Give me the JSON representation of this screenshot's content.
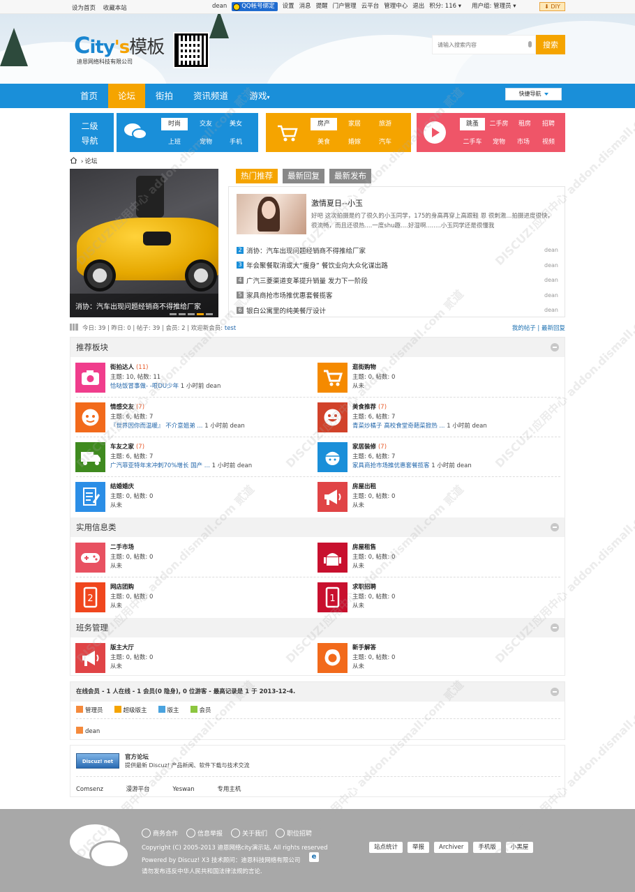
{
  "topbar": {
    "left": [
      "设为首页",
      "收藏本站"
    ],
    "user": "dean",
    "qq_bind": "QQ帐号绑定",
    "items": [
      "设置",
      "消息",
      "提醒",
      "门户管理",
      "云平台",
      "管理中心",
      "退出",
      "积分: 116",
      "用户组: 管理员"
    ],
    "diy": "DIY"
  },
  "header": {
    "logo_c": "C",
    "logo_ity": "ity",
    "logo_s": "'s",
    "logo_cn": "模板",
    "logo_sub": "迪恩网络科技有限公司",
    "search_placeholder": "请输入搜索内容",
    "search_button": "搜索"
  },
  "nav": {
    "items": [
      "首页",
      "论坛",
      "街拍",
      "资讯频道",
      "游戏"
    ],
    "active": "论坛",
    "quick": "快捷导航"
  },
  "subnav": {
    "label1": "二级",
    "label2": "导航",
    "group1": [
      "时尚",
      "交友",
      "美女",
      "上班",
      "宠物",
      "手机"
    ],
    "group2": [
      "房产",
      "家居",
      "旅游",
      "美食",
      "婚嫁",
      "汽车"
    ],
    "group3": [
      "跳蚤",
      "二手房",
      "租房",
      "招聘",
      "二手车",
      "宠物",
      "市场",
      "视频"
    ],
    "colors": {
      "blue": "#1a8fd9",
      "orange": "#f5a400",
      "red": "#ef5568"
    }
  },
  "breadcrumb": "论坛",
  "slide": {
    "caption": "消协：汽车出现问题经销商不得推给厂家"
  },
  "hot": {
    "tabs": [
      "热门推荐",
      "最新回复",
      "最新发布"
    ],
    "feature_title": "激情夏日--小玉",
    "feature_desc": "好吧 这次拍摄是约了很久的小玉同学，175的身高再穿上高跟鞋 恩 很刺激...拍摄进度很快，很流畅，而且还很热....一度shu趣....好湿啊........小玉同学还是很懂我",
    "list": [
      {
        "n": "2",
        "t": "消协：汽车出现问题经销商不得推给厂家",
        "a": "dean"
      },
      {
        "n": "3",
        "t": "年会聚餐取消或大“瘦身” 餐饮业向大众化谋出路",
        "a": "dean"
      },
      {
        "n": "4",
        "t": "广汽三菱渠道变革提升销量 发力下一阶段",
        "a": "dean"
      },
      {
        "n": "5",
        "t": "家具商抢市场推优惠套餐揽客",
        "a": "dean"
      },
      {
        "n": "6",
        "t": "银白公寓里的纯美餐厅设计",
        "a": "dean"
      }
    ]
  },
  "stats": {
    "text": "今日: 39 | 昨日: 0 | 帖子: 39 | 会员: 2 | 欢迎新会员: ",
    "newmember": "test",
    "right1": "我的帖子",
    "right2": "最新回复"
  },
  "sections": [
    {
      "title": "推荐板块",
      "forums": [
        {
          "name": "街拍达人",
          "count": "(11)",
          "stat": "主题: 10, 帖数: 11",
          "last": "恰哒饭冒事做- -哏DU少年",
          "time": " 1 小时前 dean",
          "icon": "camera-icon",
          "color": "#f03d8c"
        },
        {
          "name": "逛街购物",
          "count": "",
          "stat": "主题: 0, 帖数: 0",
          "last": "",
          "time": "从未",
          "icon": "cart-icon",
          "color": "#f58a00"
        },
        {
          "name": "情感交友",
          "count": "(7)",
          "stat": "主题: 6, 帖数: 7",
          "last": "『世界因你而温暖』 不介意姐弟 ...",
          "time": " 1 小时前 dean",
          "icon": "face-icon",
          "color": "#f26a1b"
        },
        {
          "name": "美食推荐",
          "count": "(7)",
          "stat": "主题: 6, 帖数: 7",
          "last": "青菜炒橘子 高校食堂奇葩菜掀热 ...",
          "time": " 1 小时前 dean",
          "icon": "smile-icon",
          "color": "#d1422a"
        },
        {
          "name": "车友之家",
          "count": "(7)",
          "stat": "主题: 6, 帖数: 7",
          "last": "广汽菲亚特年末冲刺70%增长 国产 ...",
          "time": " 1 小时前 dean",
          "icon": "truck-icon",
          "color": "#3f8a1f"
        },
        {
          "name": "家居装修",
          "count": "(7)",
          "stat": "主题: 6, 帖数: 7",
          "last": "家具商抢市场推优惠套餐揽客",
          "time": " 1 小时前 dean",
          "icon": "worker-icon",
          "color": "#1a8fd9"
        },
        {
          "name": "结婚婚庆",
          "count": "",
          "stat": "主题: 0, 帖数: 0",
          "last": "",
          "time": "从未",
          "icon": "document-icon",
          "color": "#2b8ee6"
        },
        {
          "name": "房屋出租",
          "count": "",
          "stat": "主题: 0, 帖数: 0",
          "last": "",
          "time": "从未",
          "icon": "megaphone-icon",
          "color": "#e04446"
        }
      ]
    },
    {
      "title": "实用信息类",
      "forums": [
        {
          "name": "二手市场",
          "count": "",
          "stat": "主题: 0, 帖数: 0",
          "last": "",
          "time": "从未",
          "icon": "gamepad-icon",
          "color": "#e85161"
        },
        {
          "name": "房屋租售",
          "count": "",
          "stat": "主题: 0, 帖数: 0",
          "last": "",
          "time": "从未",
          "icon": "android-icon",
          "color": "#c8102e"
        },
        {
          "name": "网店团购",
          "count": "",
          "stat": "主题: 0, 帖数: 0",
          "last": "",
          "time": "从未",
          "icon": "phone-2-icon",
          "color": "#f0461d"
        },
        {
          "name": "求职招聘",
          "count": "",
          "stat": "主题: 0, 帖数: 0",
          "last": "",
          "time": "从未",
          "icon": "phone-1-icon",
          "color": "#c8102e"
        }
      ]
    },
    {
      "title": "班务管理",
      "forums": [
        {
          "name": "版主大厅",
          "count": "",
          "stat": "主题: 0, 帖数: 0",
          "last": "",
          "time": "从未",
          "icon": "megaphone-icon",
          "color": "#e04446"
        },
        {
          "name": "新手解答",
          "count": "",
          "stat": "主题: 0, 帖数: 0",
          "last": "",
          "time": "从未",
          "icon": "support-icon",
          "color": "#f26a1b"
        }
      ]
    }
  ],
  "online": {
    "title": "在线会员 - 1 人在线 - 1 会员(0 隐身), 0 位游客 - 最高记录是 1 于 2013-12-4.",
    "badges": [
      "管理员",
      "超级版主",
      "版主",
      "会员"
    ],
    "badge_colors": [
      "#f58a3c",
      "#f5a400",
      "#4aa3df",
      "#8cc63f"
    ],
    "user": "dean"
  },
  "links": {
    "logo_text": "Discuz! net",
    "name": "官方论坛",
    "desc": "提供最新 Discuz! 产品新闻、软件下载与技术交流",
    "items": [
      "Comsenz",
      "漫游平台",
      "Yeswan",
      "专用主机"
    ]
  },
  "footer": {
    "links": [
      "商务合作",
      "信息举报",
      "关于我们",
      "职位招聘"
    ],
    "copy1": "Copyright (C) 2005-2013 迪恩网络city演示站, All rights reserved",
    "copy2": "Powered by Discuz! X3 技术顾问：迪恩科技网络有限公司",
    "copy3": "请勿发布违反中华人民共和国法律法规的言论.",
    "buttons": [
      "站点统计",
      "举报",
      "Archiver",
      "手机版",
      "小黑屋"
    ]
  },
  "watermark": "DISCUZ!应用中心 addon.dismall.com 贰道"
}
